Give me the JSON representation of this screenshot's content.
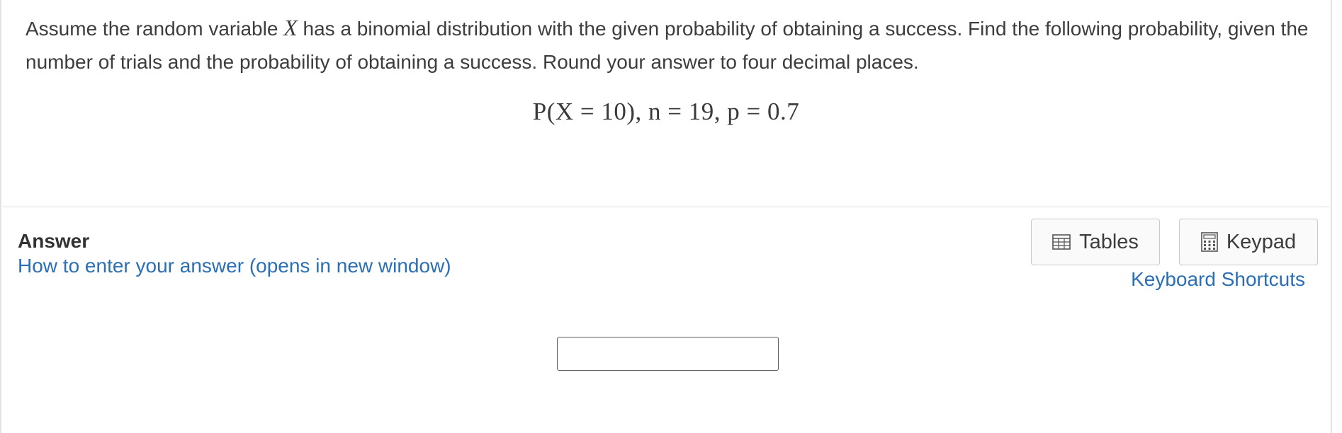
{
  "question": {
    "prompt_before_var": "Assume the random variable ",
    "variable": "X",
    "prompt_after_var": " has a binomial distribution with the given probability of obtaining a success. Find the following probability, given the number of trials and the probability of obtaining a success. Round your answer to four decimal places.",
    "formula": "P(X = 10), n = 19, p = 0.7"
  },
  "answer": {
    "label": "Answer",
    "help_link": "How to enter your answer (opens in new window)",
    "input_value": "",
    "input_placeholder": ""
  },
  "tools": {
    "tables_label": "Tables",
    "keypad_label": "Keypad",
    "shortcuts_label": "Keyboard Shortcuts"
  },
  "icons": {
    "tables": "table-grid-icon",
    "keypad": "calculator-icon"
  },
  "colors": {
    "link": "#2a6fb5",
    "text": "#3d3d3d",
    "border": "#c9c9c9"
  }
}
